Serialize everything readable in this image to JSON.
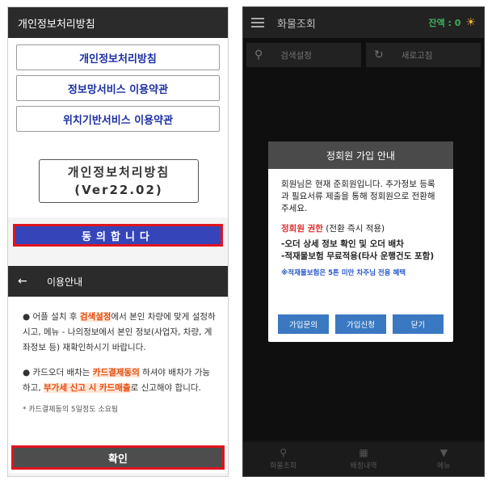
{
  "left": {
    "header_title": "개인정보처리방침",
    "policy_links": [
      "개인정보처리방침",
      "정보망서비스 이용약관",
      "위치기반서비스 이용약관"
    ],
    "version_line1": "개인정보처리방침",
    "version_line2": "(Ver22.02)",
    "agree_button": "동의합니다",
    "info_header": "이용안내",
    "back_icon": "arrow-left-icon",
    "info": {
      "p1_a": "● 어플 설치 후 ",
      "p1_hl": "검색설정",
      "p1_b": "에서 본인 차량에 맞게 설정하시고, 메뉴 - 나의정보에서 본인 정보(사업자, 차량, 계좌정보 등) 재확인하시기 바랍니다.",
      "p2_a": "● 카드오더 배차는 ",
      "p2_hl1": "카드결제동의",
      "p2_b": " 하셔야 배차가 가능하고, ",
      "p2_hl2": "부가세 신고 시 카드매출",
      "p2_c": "로 신고해야 합니다.",
      "note": "* 카드결제동의 5일정도 소요됨"
    },
    "confirm_button": "확인",
    "highlight_color": "#e0141e"
  },
  "right": {
    "app_title": "화물조회",
    "balance": "잔액 : 0",
    "search_button": "검색설정",
    "refresh_button": "새로고침",
    "nav": [
      {
        "label": "화물조회",
        "icon": "search-icon"
      },
      {
        "label": "배정내역",
        "icon": "calendar-icon"
      },
      {
        "label": "메뉴",
        "icon": "chevron-down-circle-icon"
      }
    ],
    "dialog": {
      "title": "정회원 가입 안내",
      "intro": "회원님은 현재 준회원입니다. 추가정보 등록과 필요서류 제출을 통해 정회원으로 전환해주세요.",
      "perm_title": "정회원 권한",
      "perm_suffix": " (전환 즉시 적용)",
      "perm_items": [
        "-오더 상세 정보 확인 및 오더 배차",
        "-적재물보험 무료적용(타사 운행건도 포함)"
      ],
      "note": "※적재물보험은 5톤 미만 차주님 전용 혜택",
      "buttons": [
        "가입문의",
        "가입신청",
        "닫기"
      ]
    }
  }
}
